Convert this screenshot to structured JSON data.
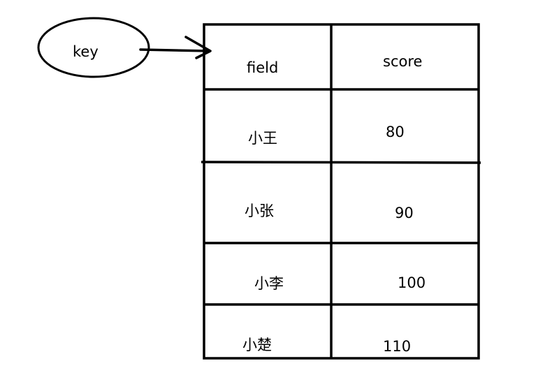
{
  "key_label": "key",
  "table": {
    "headers": {
      "field": "field",
      "score": "score"
    },
    "rows": [
      {
        "field": "小王",
        "score": "80"
      },
      {
        "field": "小张",
        "score": "90"
      },
      {
        "field": "小李",
        "score": "100"
      },
      {
        "field": "小楚",
        "score": "110"
      }
    ]
  }
}
